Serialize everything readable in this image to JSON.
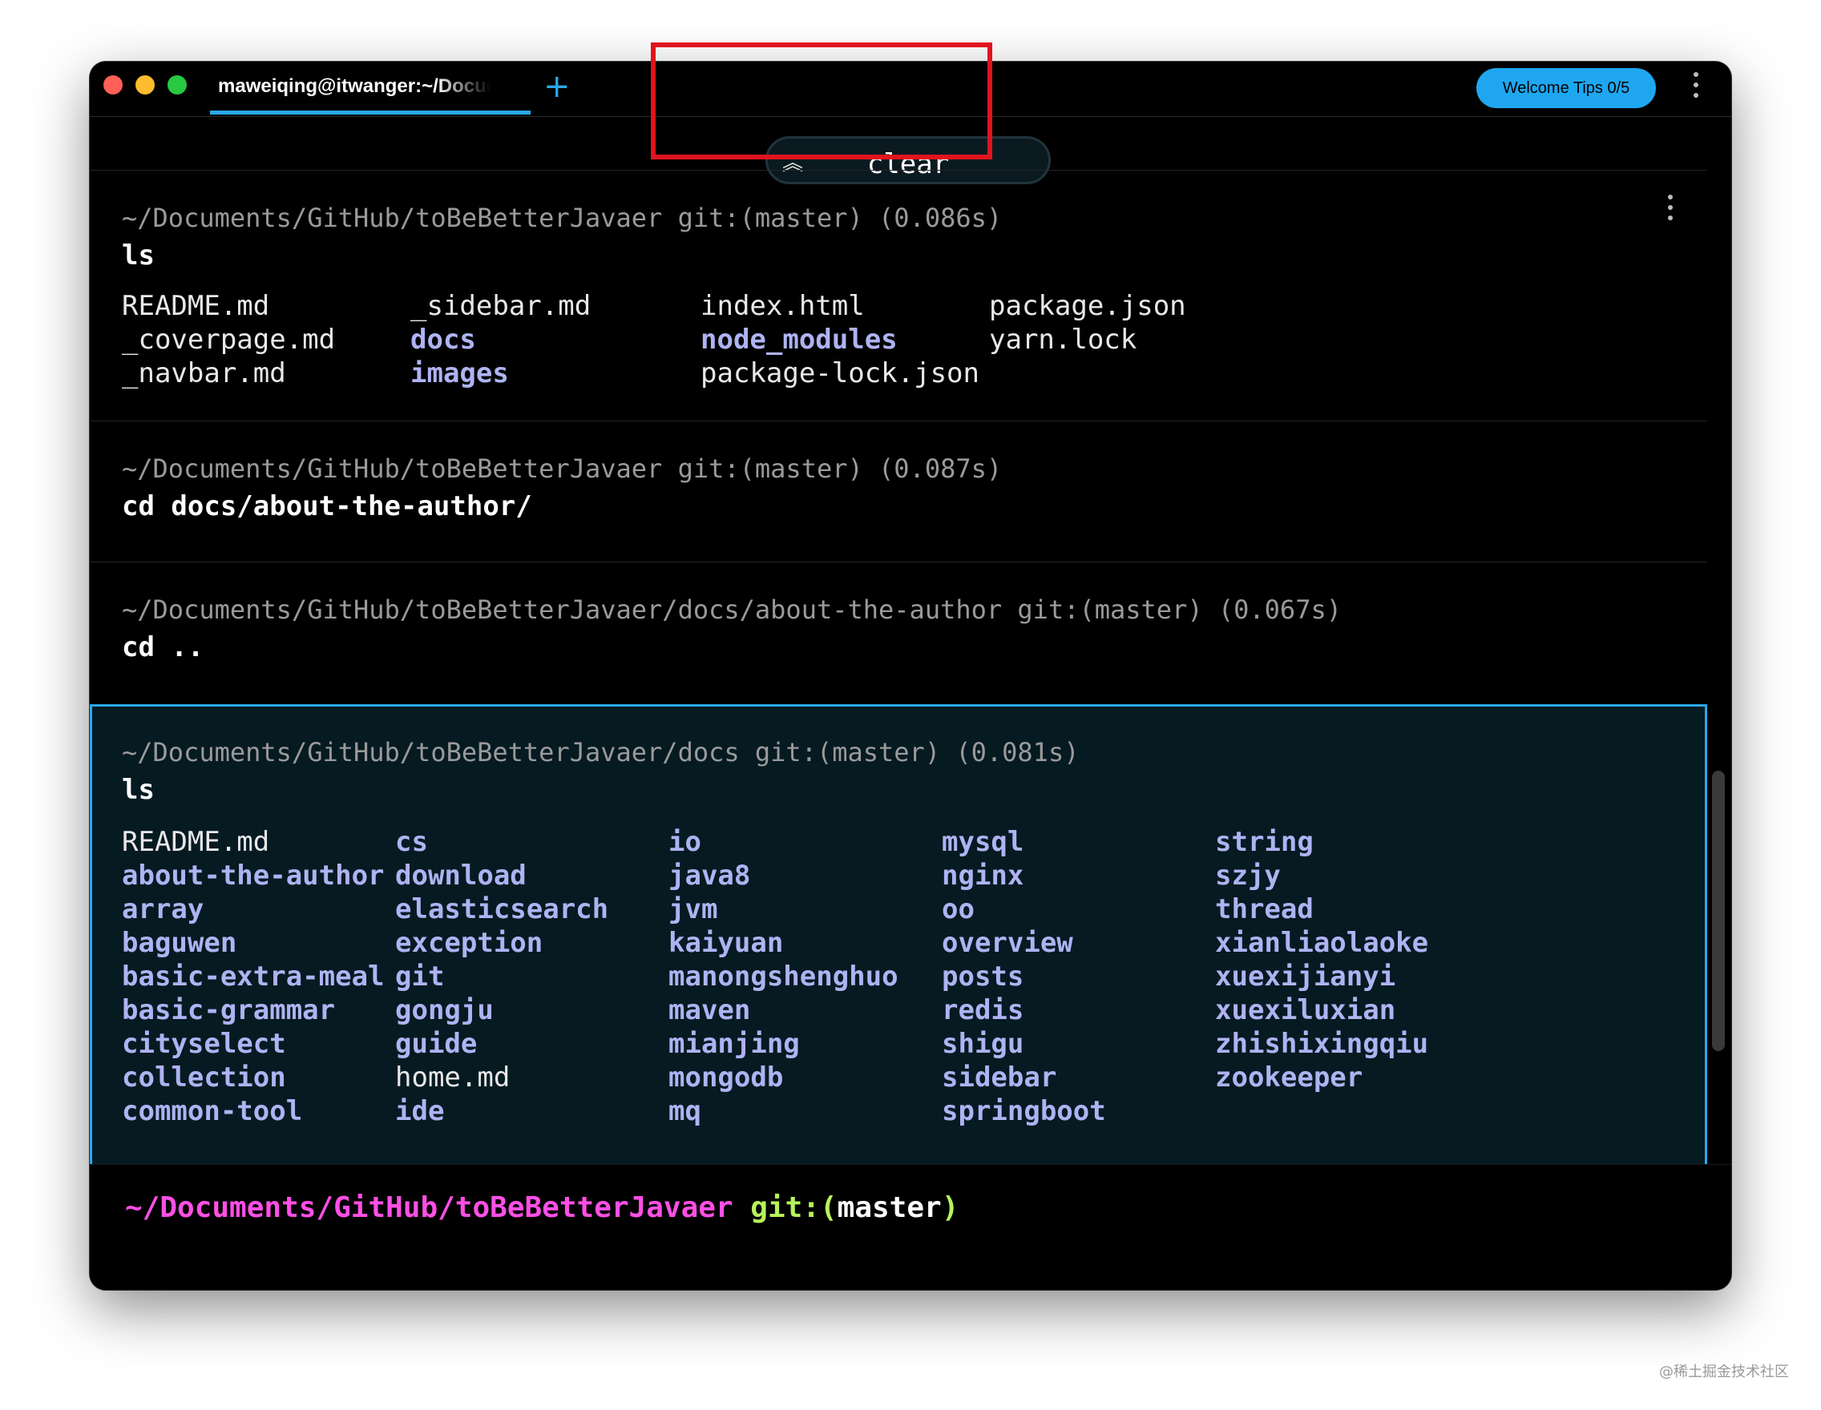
{
  "tab": {
    "title": "maweiqing@itwanger:~/Documents/GitHub/toBeBetterJavaer",
    "new_tab": "+"
  },
  "header": {
    "welcome_label": "Welcome Tips 0/5"
  },
  "sticky": {
    "command": "clear",
    "chevron": "«"
  },
  "blocks": [
    {
      "prompt": "~/Documents/GitHub/toBeBetterJavaer git:(master) (0.086s)",
      "command": "ls",
      "columns": [
        [
          {
            "t": "README.md",
            "k": "file"
          },
          {
            "t": "_coverpage.md",
            "k": "file"
          },
          {
            "t": "_navbar.md",
            "k": "file"
          }
        ],
        [
          {
            "t": "_sidebar.md",
            "k": "file"
          },
          {
            "t": "docs",
            "k": "dir"
          },
          {
            "t": "images",
            "k": "dir"
          }
        ],
        [
          {
            "t": "index.html",
            "k": "file"
          },
          {
            "t": "node_modules",
            "k": "dir"
          },
          {
            "t": "package-lock.json",
            "k": "file"
          }
        ],
        [
          {
            "t": "package.json",
            "k": "file"
          },
          {
            "t": "yarn.lock",
            "k": "file"
          }
        ]
      ]
    },
    {
      "prompt": "~/Documents/GitHub/toBeBetterJavaer git:(master) (0.087s)",
      "command": "cd docs/about-the-author/"
    },
    {
      "prompt": "~/Documents/GitHub/toBeBetterJavaer/docs/about-the-author git:(master) (0.067s)",
      "command": "cd .."
    },
    {
      "prompt": "~/Documents/GitHub/toBeBetterJavaer/docs git:(master) (0.081s)",
      "command": "ls",
      "columns": [
        [
          {
            "t": "README.md",
            "k": "file"
          },
          {
            "t": "about-the-author",
            "k": "dir"
          },
          {
            "t": "array",
            "k": "dir"
          },
          {
            "t": "baguwen",
            "k": "dir"
          },
          {
            "t": "basic-extra-meal",
            "k": "dir"
          },
          {
            "t": "basic-grammar",
            "k": "dir"
          },
          {
            "t": "cityselect",
            "k": "dir"
          },
          {
            "t": "collection",
            "k": "dir"
          },
          {
            "t": "common-tool",
            "k": "dir"
          }
        ],
        [
          {
            "t": "cs",
            "k": "dir"
          },
          {
            "t": "download",
            "k": "dir"
          },
          {
            "t": "elasticsearch",
            "k": "dir"
          },
          {
            "t": "exception",
            "k": "dir"
          },
          {
            "t": "git",
            "k": "dir"
          },
          {
            "t": "gongju",
            "k": "dir"
          },
          {
            "t": "guide",
            "k": "dir"
          },
          {
            "t": "home.md",
            "k": "file"
          },
          {
            "t": "ide",
            "k": "dir"
          }
        ],
        [
          {
            "t": "io",
            "k": "dir"
          },
          {
            "t": "java8",
            "k": "dir"
          },
          {
            "t": "jvm",
            "k": "dir"
          },
          {
            "t": "kaiyuan",
            "k": "dir"
          },
          {
            "t": "manongshenghuo",
            "k": "dir"
          },
          {
            "t": "maven",
            "k": "dir"
          },
          {
            "t": "mianjing",
            "k": "dir"
          },
          {
            "t": "mongodb",
            "k": "dir"
          },
          {
            "t": "mq",
            "k": "dir"
          }
        ],
        [
          {
            "t": "mysql",
            "k": "dir"
          },
          {
            "t": "nginx",
            "k": "dir"
          },
          {
            "t": "oo",
            "k": "dir"
          },
          {
            "t": "overview",
            "k": "dir"
          },
          {
            "t": "posts",
            "k": "dir"
          },
          {
            "t": "redis",
            "k": "dir"
          },
          {
            "t": "shigu",
            "k": "dir"
          },
          {
            "t": "sidebar",
            "k": "dir"
          },
          {
            "t": "springboot",
            "k": "dir"
          }
        ],
        [
          {
            "t": "string",
            "k": "dir"
          },
          {
            "t": "szjy",
            "k": "dir"
          },
          {
            "t": "thread",
            "k": "dir"
          },
          {
            "t": "xianliaolaoke",
            "k": "dir"
          },
          {
            "t": "xuexijianyi",
            "k": "dir"
          },
          {
            "t": "xuexiluxian",
            "k": "dir"
          },
          {
            "t": "zhishixingqiu",
            "k": "dir"
          },
          {
            "t": "zookeeper",
            "k": "dir"
          }
        ]
      ]
    }
  ],
  "input": {
    "path": "~/Documents/GitHub/toBeBetterJavaer",
    "git": "git:(",
    "branch": "master",
    "close": ")"
  },
  "watermark": "@稀土掘金技术社区",
  "colors": {
    "accent": "#2aa7ea",
    "dir": "#aeb3f2",
    "prompt_path": "#ff4fe5",
    "prompt_git": "#b6f35b",
    "highlight_box": "#e0141e"
  }
}
